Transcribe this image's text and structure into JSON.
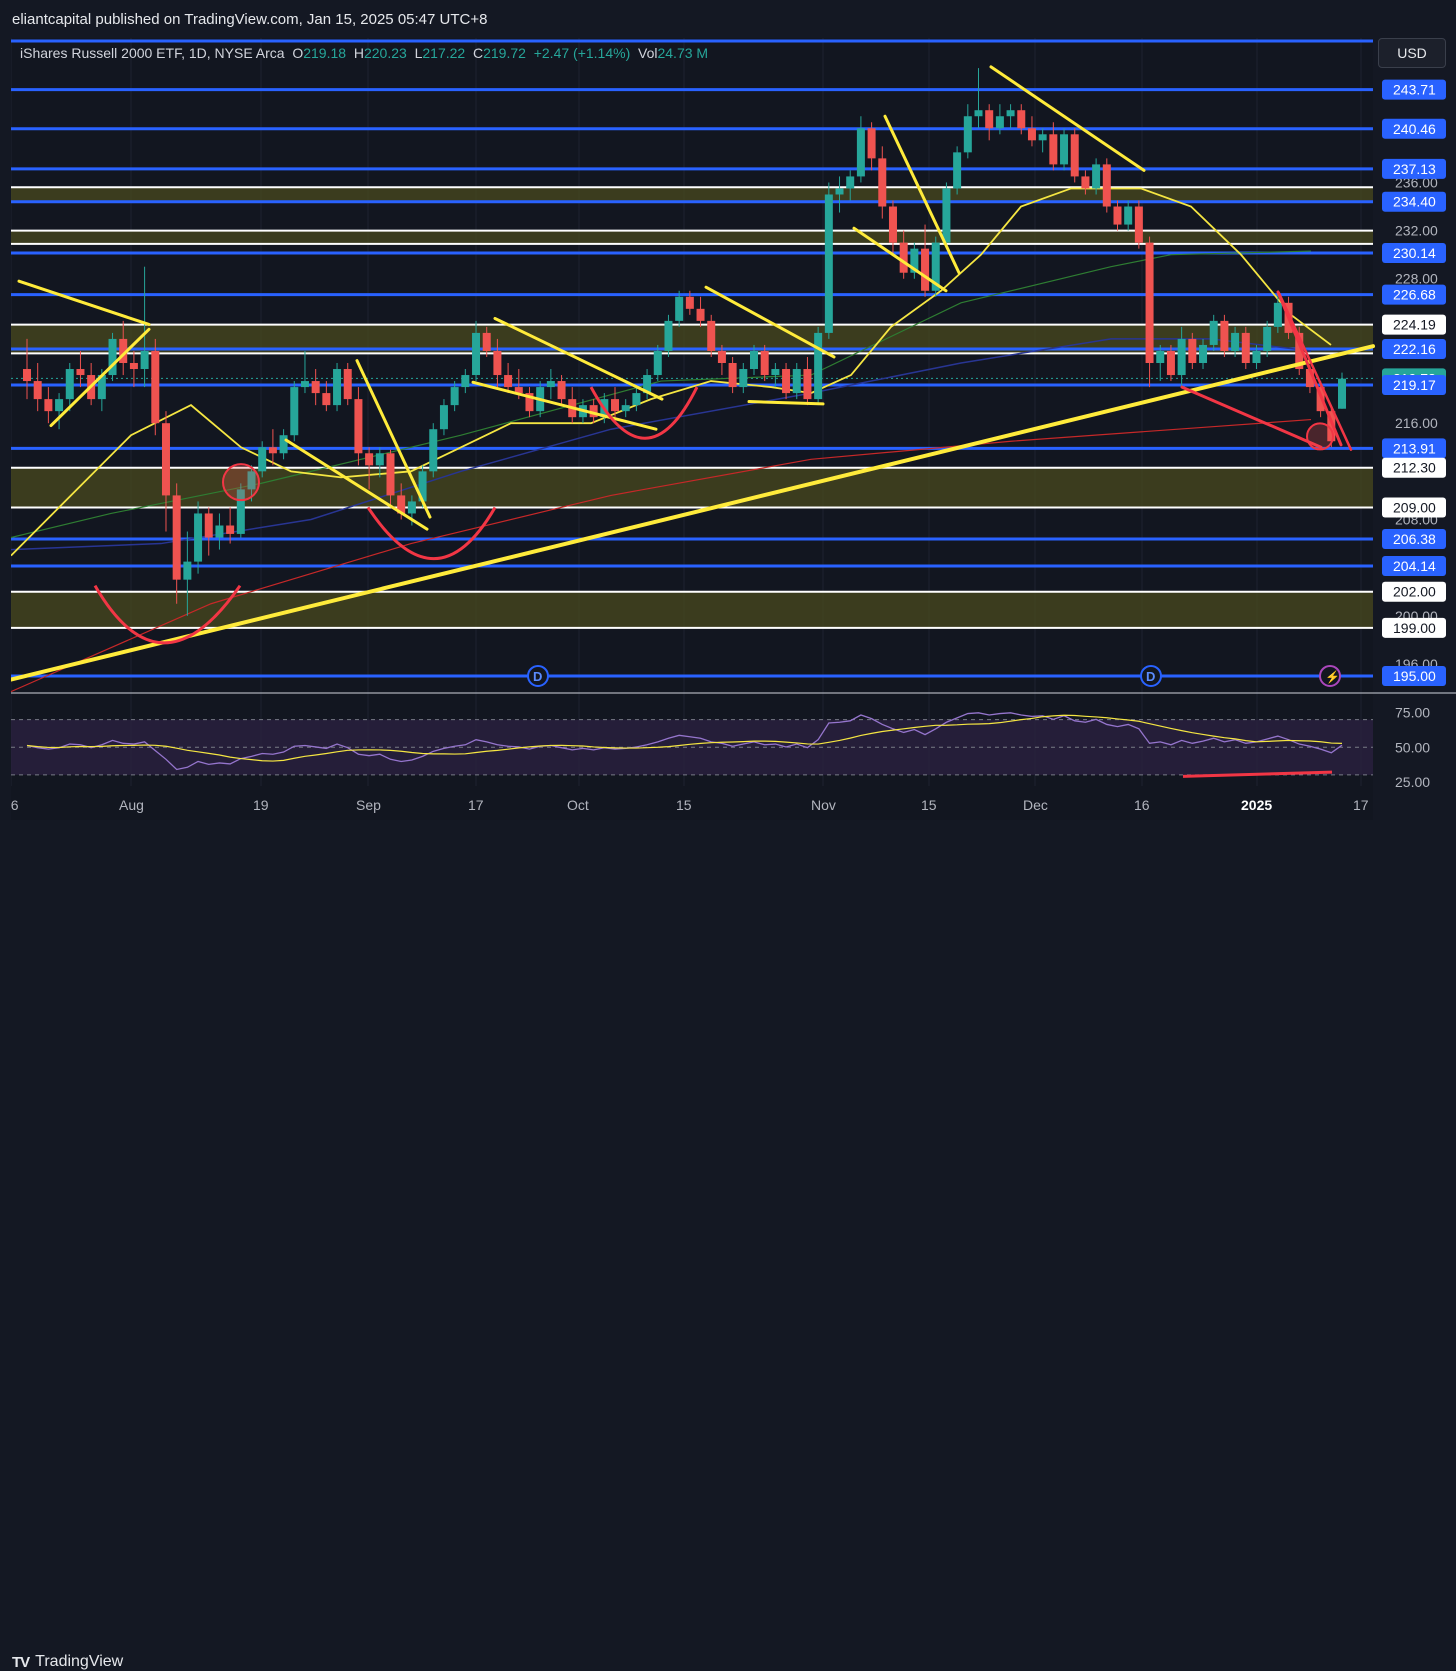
{
  "header": {
    "publisher": "eliantcapital published on TradingView.com, Jan 15, 2025 05:47 UTC+8"
  },
  "legend": {
    "name": "iShares Russell 2000 ETF, 1D, NYSE Arca",
    "open_label": "O",
    "open": "219.18",
    "high_label": "H",
    "high": "220.23",
    "low_label": "L",
    "low": "217.22",
    "close_label": "C",
    "close": "219.72",
    "change": "+2.47 (+1.14%)",
    "vol_label": "Vol",
    "vol": "24.73 M"
  },
  "currency_button": "USD",
  "footer": {
    "brand": "TradingView"
  },
  "colors": {
    "up": "#26a69a",
    "down": "#ef5350",
    "level_line": "#2962ff",
    "trendline": "#ffeb3b",
    "pattern": "#f23645",
    "zone_fill": "#4a4a1e",
    "ma_short": "#f5e642",
    "ma_mid": "#2e7d32",
    "ma_long": "#1a237e",
    "ma_200": "#b71c1c",
    "rsi_line": "#9575cd",
    "rsi_ma": "#f5e642"
  },
  "chart_data": [
    {
      "type": "candlestick",
      "title": "iShares Russell 2000 ETF, 1D, NYSE Arca",
      "ylim": [
        194,
        248
      ],
      "x_ticks": [
        "16",
        "Aug",
        "19",
        "Sep",
        "17",
        "Oct",
        "15",
        "Nov",
        "15",
        "Dec",
        "16",
        "2025",
        "17"
      ],
      "y_ticks": [
        "196.00",
        "200.00",
        "204.00",
        "208.00",
        "212.00",
        "216.00",
        "220.00",
        "224.00",
        "228.00",
        "232.00",
        "236.00"
      ],
      "level_labels": [
        {
          "value": 243.71,
          "label": "243.71",
          "style": "level"
        },
        {
          "value": 240.46,
          "label": "240.46",
          "style": "level"
        },
        {
          "value": 237.13,
          "label": "237.13",
          "style": "level"
        },
        {
          "value": 234.4,
          "label": "234.40",
          "style": "level"
        },
        {
          "value": 230.14,
          "label": "230.14",
          "style": "level"
        },
        {
          "value": 226.68,
          "label": "226.68",
          "style": "level"
        },
        {
          "value": 224.19,
          "label": "224.19",
          "style": "zone"
        },
        {
          "value": 222.16,
          "label": "222.16",
          "style": "level"
        },
        {
          "value": 219.72,
          "label": "219.72",
          "style": "price"
        },
        {
          "value": 219.17,
          "label": "219.17",
          "style": "level"
        },
        {
          "value": 213.91,
          "label": "213.91",
          "style": "level"
        },
        {
          "value": 212.3,
          "label": "212.30",
          "style": "zone"
        },
        {
          "value": 209.0,
          "label": "209.00",
          "style": "zone"
        },
        {
          "value": 206.38,
          "label": "206.38",
          "style": "level"
        },
        {
          "value": 204.14,
          "label": "204.14",
          "style": "level"
        },
        {
          "value": 202.0,
          "label": "202.00",
          "style": "zone"
        },
        {
          "value": 199.0,
          "label": "199.00",
          "style": "zone"
        },
        {
          "value": 195.0,
          "label": "195.00",
          "style": "level"
        }
      ],
      "zones": [
        {
          "from": 221.8,
          "to": 224.19
        },
        {
          "from": 209.0,
          "to": 212.3
        },
        {
          "from": 199.0,
          "to": 202.0
        },
        {
          "from": 234.4,
          "to": 235.6
        },
        {
          "from": 230.9,
          "to": 232.0
        }
      ],
      "dividend_markers": [
        "D",
        "D"
      ],
      "candles": [
        [
          220.5,
          223.0,
          218.0,
          219.5
        ],
        [
          219.5,
          221.0,
          217.0,
          218.0
        ],
        [
          218.0,
          219.0,
          216.0,
          217.0
        ],
        [
          217.0,
          218.5,
          215.5,
          218.0
        ],
        [
          218.0,
          221.0,
          217.0,
          220.5
        ],
        [
          220.5,
          222.0,
          219.0,
          220.0
        ],
        [
          220.0,
          221.0,
          217.5,
          218.0
        ],
        [
          218.0,
          220.5,
          217.0,
          220.0
        ],
        [
          220.0,
          223.5,
          219.5,
          223.0
        ],
        [
          223.0,
          224.5,
          220.0,
          221.0
        ],
        [
          221.0,
          222.0,
          219.0,
          220.5
        ],
        [
          220.5,
          229.0,
          219.0,
          222.0
        ],
        [
          222.0,
          223.0,
          215.0,
          216.0
        ],
        [
          216.0,
          217.0,
          207.0,
          210.0
        ],
        [
          210.0,
          211.0,
          201.0,
          203.0
        ],
        [
          203.0,
          207.0,
          200.0,
          204.5
        ],
        [
          204.5,
          209.5,
          203.5,
          208.5
        ],
        [
          208.5,
          209.0,
          205.0,
          206.5
        ],
        [
          206.5,
          208.5,
          205.5,
          207.5
        ],
        [
          207.5,
          209.0,
          206.0,
          206.8
        ],
        [
          206.8,
          211.0,
          206.5,
          210.5
        ],
        [
          210.5,
          212.5,
          209.5,
          212.0
        ],
        [
          212.0,
          214.5,
          211.5,
          214.0
        ],
        [
          214.0,
          215.5,
          212.5,
          213.5
        ],
        [
          213.5,
          215.5,
          213.0,
          215.0
        ],
        [
          215.0,
          219.5,
          214.5,
          219.0
        ],
        [
          219.0,
          222.0,
          218.5,
          219.5
        ],
        [
          219.5,
          220.5,
          217.5,
          218.5
        ],
        [
          218.5,
          219.5,
          217.0,
          217.5
        ],
        [
          217.5,
          221.0,
          217.0,
          220.5
        ],
        [
          220.5,
          221.0,
          217.5,
          218.0
        ],
        [
          218.0,
          219.0,
          212.5,
          213.5
        ],
        [
          213.5,
          214.0,
          210.5,
          212.5
        ],
        [
          212.5,
          214.0,
          211.5,
          213.5
        ],
        [
          213.5,
          213.8,
          209.0,
          210.0
        ],
        [
          210.0,
          211.0,
          208.0,
          208.5
        ],
        [
          208.5,
          210.0,
          207.5,
          209.5
        ],
        [
          209.5,
          212.5,
          209.0,
          212.0
        ],
        [
          212.0,
          216.0,
          211.5,
          215.5
        ],
        [
          215.5,
          218.0,
          215.0,
          217.5
        ],
        [
          217.5,
          219.5,
          217.0,
          219.0
        ],
        [
          219.0,
          220.5,
          218.5,
          220.0
        ],
        [
          220.0,
          224.5,
          219.5,
          223.5
        ],
        [
          223.5,
          224.0,
          221.5,
          222.0
        ],
        [
          222.0,
          223.0,
          219.0,
          220.0
        ],
        [
          220.0,
          221.0,
          218.5,
          219.0
        ],
        [
          219.0,
          220.5,
          218.0,
          218.5
        ],
        [
          218.5,
          219.0,
          216.5,
          217.0
        ],
        [
          217.0,
          219.5,
          216.5,
          219.0
        ],
        [
          219.0,
          220.5,
          218.0,
          219.5
        ],
        [
          219.5,
          220.0,
          217.5,
          218.0
        ],
        [
          218.0,
          219.0,
          216.0,
          216.5
        ],
        [
          216.5,
          218.0,
          216.0,
          217.5
        ],
        [
          217.5,
          218.0,
          216.0,
          216.5
        ],
        [
          216.5,
          218.5,
          216.0,
          218.0
        ],
        [
          218.0,
          219.0,
          216.5,
          217.0
        ],
        [
          217.0,
          218.0,
          216.5,
          217.5
        ],
        [
          217.5,
          219.0,
          217.0,
          218.5
        ],
        [
          218.5,
          220.5,
          218.0,
          220.0
        ],
        [
          220.0,
          222.5,
          219.5,
          222.0
        ],
        [
          222.0,
          225.0,
          221.5,
          224.5
        ],
        [
          224.5,
          227.0,
          224.0,
          226.5
        ],
        [
          226.5,
          227.0,
          225.0,
          225.5
        ],
        [
          225.5,
          226.5,
          224.0,
          224.5
        ],
        [
          224.5,
          225.0,
          221.5,
          222.0
        ],
        [
          222.0,
          222.5,
          220.0,
          221.0
        ],
        [
          221.0,
          221.5,
          218.5,
          219.0
        ],
        [
          219.0,
          221.0,
          218.5,
          220.5
        ],
        [
          220.5,
          222.5,
          220.0,
          222.0
        ],
        [
          222.0,
          222.5,
          219.5,
          220.0
        ],
        [
          220.0,
          221.0,
          219.0,
          220.5
        ],
        [
          220.5,
          221.0,
          218.0,
          218.5
        ],
        [
          218.5,
          221.0,
          218.0,
          220.5
        ],
        [
          220.5,
          221.5,
          217.5,
          218.0
        ],
        [
          218.0,
          224.0,
          217.5,
          223.5
        ],
        [
          223.5,
          236.0,
          223.0,
          235.0
        ],
        [
          235.0,
          236.5,
          233.5,
          235.5
        ],
        [
          235.5,
          237.0,
          234.5,
          236.5
        ],
        [
          236.5,
          241.5,
          236.0,
          240.5
        ],
        [
          240.5,
          241.0,
          237.0,
          238.0
        ],
        [
          238.0,
          239.0,
          233.0,
          234.0
        ],
        [
          234.0,
          234.5,
          230.0,
          231.0
        ],
        [
          231.0,
          232.0,
          228.0,
          228.5
        ],
        [
          228.5,
          231.0,
          228.0,
          230.5
        ],
        [
          230.5,
          232.5,
          226.5,
          227.0
        ],
        [
          227.0,
          231.5,
          226.5,
          231.0
        ],
        [
          231.0,
          236.0,
          230.5,
          235.5
        ],
        [
          235.5,
          239.0,
          235.0,
          238.5
        ],
        [
          238.5,
          242.5,
          238.0,
          241.5
        ],
        [
          241.5,
          245.5,
          240.5,
          242.0
        ],
        [
          242.0,
          242.5,
          239.5,
          240.5
        ],
        [
          240.5,
          242.5,
          240.0,
          241.5
        ],
        [
          241.5,
          242.5,
          240.5,
          242.0
        ],
        [
          242.0,
          242.5,
          240.0,
          240.5
        ],
        [
          240.5,
          241.5,
          239.0,
          239.5
        ],
        [
          239.5,
          240.5,
          238.5,
          240.0
        ],
        [
          240.0,
          241.0,
          237.0,
          237.5
        ],
        [
          237.5,
          240.5,
          237.0,
          240.0
        ],
        [
          240.0,
          240.5,
          236.0,
          236.5
        ],
        [
          236.5,
          237.0,
          235.0,
          235.5
        ],
        [
          235.5,
          238.0,
          235.0,
          237.5
        ],
        [
          237.5,
          238.0,
          233.5,
          234.0
        ],
        [
          234.0,
          234.5,
          232.0,
          232.5
        ],
        [
          232.5,
          234.5,
          232.0,
          234.0
        ],
        [
          234.0,
          234.5,
          230.5,
          231.0
        ],
        [
          231.0,
          231.5,
          219.0,
          221.0
        ],
        [
          221.0,
          222.5,
          219.5,
          222.0
        ],
        [
          222.0,
          222.5,
          219.5,
          220.0
        ],
        [
          220.0,
          224.0,
          219.0,
          223.0
        ],
        [
          223.0,
          223.5,
          220.5,
          221.0
        ],
        [
          221.0,
          223.0,
          220.5,
          222.5
        ],
        [
          222.5,
          225.0,
          222.0,
          224.5
        ],
        [
          224.5,
          225.0,
          221.5,
          222.0
        ],
        [
          222.0,
          224.0,
          221.5,
          223.5
        ],
        [
          223.5,
          224.0,
          220.5,
          221.0
        ],
        [
          221.0,
          222.5,
          220.5,
          222.0
        ],
        [
          222.0,
          224.5,
          221.5,
          224.0
        ],
        [
          224.0,
          227.0,
          223.5,
          226.0
        ],
        [
          226.0,
          226.5,
          223.0,
          223.5
        ],
        [
          223.5,
          224.0,
          220.0,
          220.5
        ],
        [
          220.5,
          220.8,
          218.5,
          219.0
        ],
        [
          219.0,
          219.5,
          216.5,
          217.0
        ],
        [
          217.0,
          217.5,
          214.0,
          214.5
        ],
        [
          217.2,
          220.2,
          217.2,
          219.7
        ]
      ]
    },
    {
      "type": "line",
      "title": "RSI",
      "ylim": [
        22,
        82
      ],
      "y_ticks": [
        "25.00",
        "50.00",
        "75.00"
      ]
    }
  ]
}
